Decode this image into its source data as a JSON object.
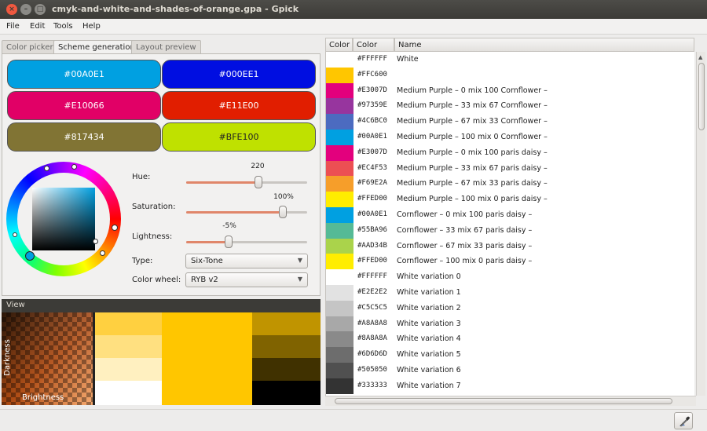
{
  "window": {
    "title": "cmyk-and-white-and-shades-of-orange.gpa - Gpick",
    "close_glyph": "×",
    "minimize_glyph": "–",
    "maximize_glyph": "□"
  },
  "menu": [
    "File",
    "Edit",
    "Tools",
    "Help"
  ],
  "tabs": [
    "Color picker",
    "Scheme generation",
    "Layout preview"
  ],
  "active_tab": "Scheme generation",
  "scheme_colors": [
    {
      "hex": "#00A0E1",
      "text_color": "#ffffff"
    },
    {
      "hex": "#000EE1",
      "text_color": "#ffffff"
    },
    {
      "hex": "#E10066",
      "text_color": "#ffffff"
    },
    {
      "hex": "#E11E00",
      "text_color": "#ffffff"
    },
    {
      "hex": "#817434",
      "text_color": "#ffffff"
    },
    {
      "hex": "#BFE100",
      "text_color": "#222222"
    }
  ],
  "controls": {
    "hue": {
      "label": "Hue:",
      "value": "220",
      "fraction": 0.61
    },
    "saturation": {
      "label": "Saturation:",
      "value": "100%",
      "fraction": 0.92
    },
    "lightness": {
      "label": "Lightness:",
      "value": "-5%",
      "fraction": 0.38
    },
    "type": {
      "label": "Type:",
      "value": "Six-Tone"
    },
    "color_wheel": {
      "label": "Color wheel:",
      "value": "RYB v2"
    }
  },
  "view": {
    "header": "View",
    "darkness_label": "Darkness",
    "brightness_label": "Brightness"
  },
  "list": {
    "columns": [
      "Color",
      "Color",
      "Name"
    ],
    "rows": [
      {
        "hex": "#FFFFFF",
        "name": "White"
      },
      {
        "hex": "#FFC600",
        "name": ""
      },
      {
        "hex": "#E3007D",
        "name": "Medium Purple – 0 mix 100 Cornflower –"
      },
      {
        "hex": "#97359E",
        "name": "Medium Purple – 33 mix 67 Cornflower –"
      },
      {
        "hex": "#4C6BC0",
        "name": "Medium Purple – 67 mix 33 Cornflower –"
      },
      {
        "hex": "#00A0E1",
        "name": "Medium Purple – 100 mix 0 Cornflower –"
      },
      {
        "hex": "#E3007D",
        "name": "Medium Purple – 0 mix 100 paris daisy –"
      },
      {
        "hex": "#EC4F53",
        "name": "Medium Purple – 33 mix 67 paris daisy –"
      },
      {
        "hex": "#F69E2A",
        "name": "Medium Purple – 67 mix 33 paris daisy –"
      },
      {
        "hex": "#FFED00",
        "name": "Medium Purple – 100 mix 0 paris daisy –"
      },
      {
        "hex": "#00A0E1",
        "name": "Cornflower – 0 mix 100 paris daisy –"
      },
      {
        "hex": "#55BA96",
        "name": "Cornflower – 33 mix 67 paris daisy –"
      },
      {
        "hex": "#AAD34B",
        "name": "Cornflower – 67 mix 33 paris daisy –"
      },
      {
        "hex": "#FFED00",
        "name": "Cornflower – 100 mix 0 paris daisy –"
      },
      {
        "hex": "#FFFFFF",
        "name": "White variation 0"
      },
      {
        "hex": "#E2E2E2",
        "name": "White variation 1"
      },
      {
        "hex": "#C5C5C5",
        "name": "White variation 2"
      },
      {
        "hex": "#A8A8A8",
        "name": "White variation 3"
      },
      {
        "hex": "#8A8A8A",
        "name": "White variation 4"
      },
      {
        "hex": "#6D6D6D",
        "name": "White variation 5"
      },
      {
        "hex": "#505050",
        "name": "White variation 6"
      },
      {
        "hex": "#333333",
        "name": "White variation 7"
      }
    ]
  },
  "icons": {
    "window_close": "close-icon",
    "window_minimize": "minimize-icon",
    "window_maximize": "maximize-icon",
    "dropdown": "chevron-down-icon",
    "pick": "eyedropper-icon"
  },
  "colors": {
    "accent": "#e0866a",
    "titlebar": "#3c3b37",
    "close": "#f0583f"
  }
}
